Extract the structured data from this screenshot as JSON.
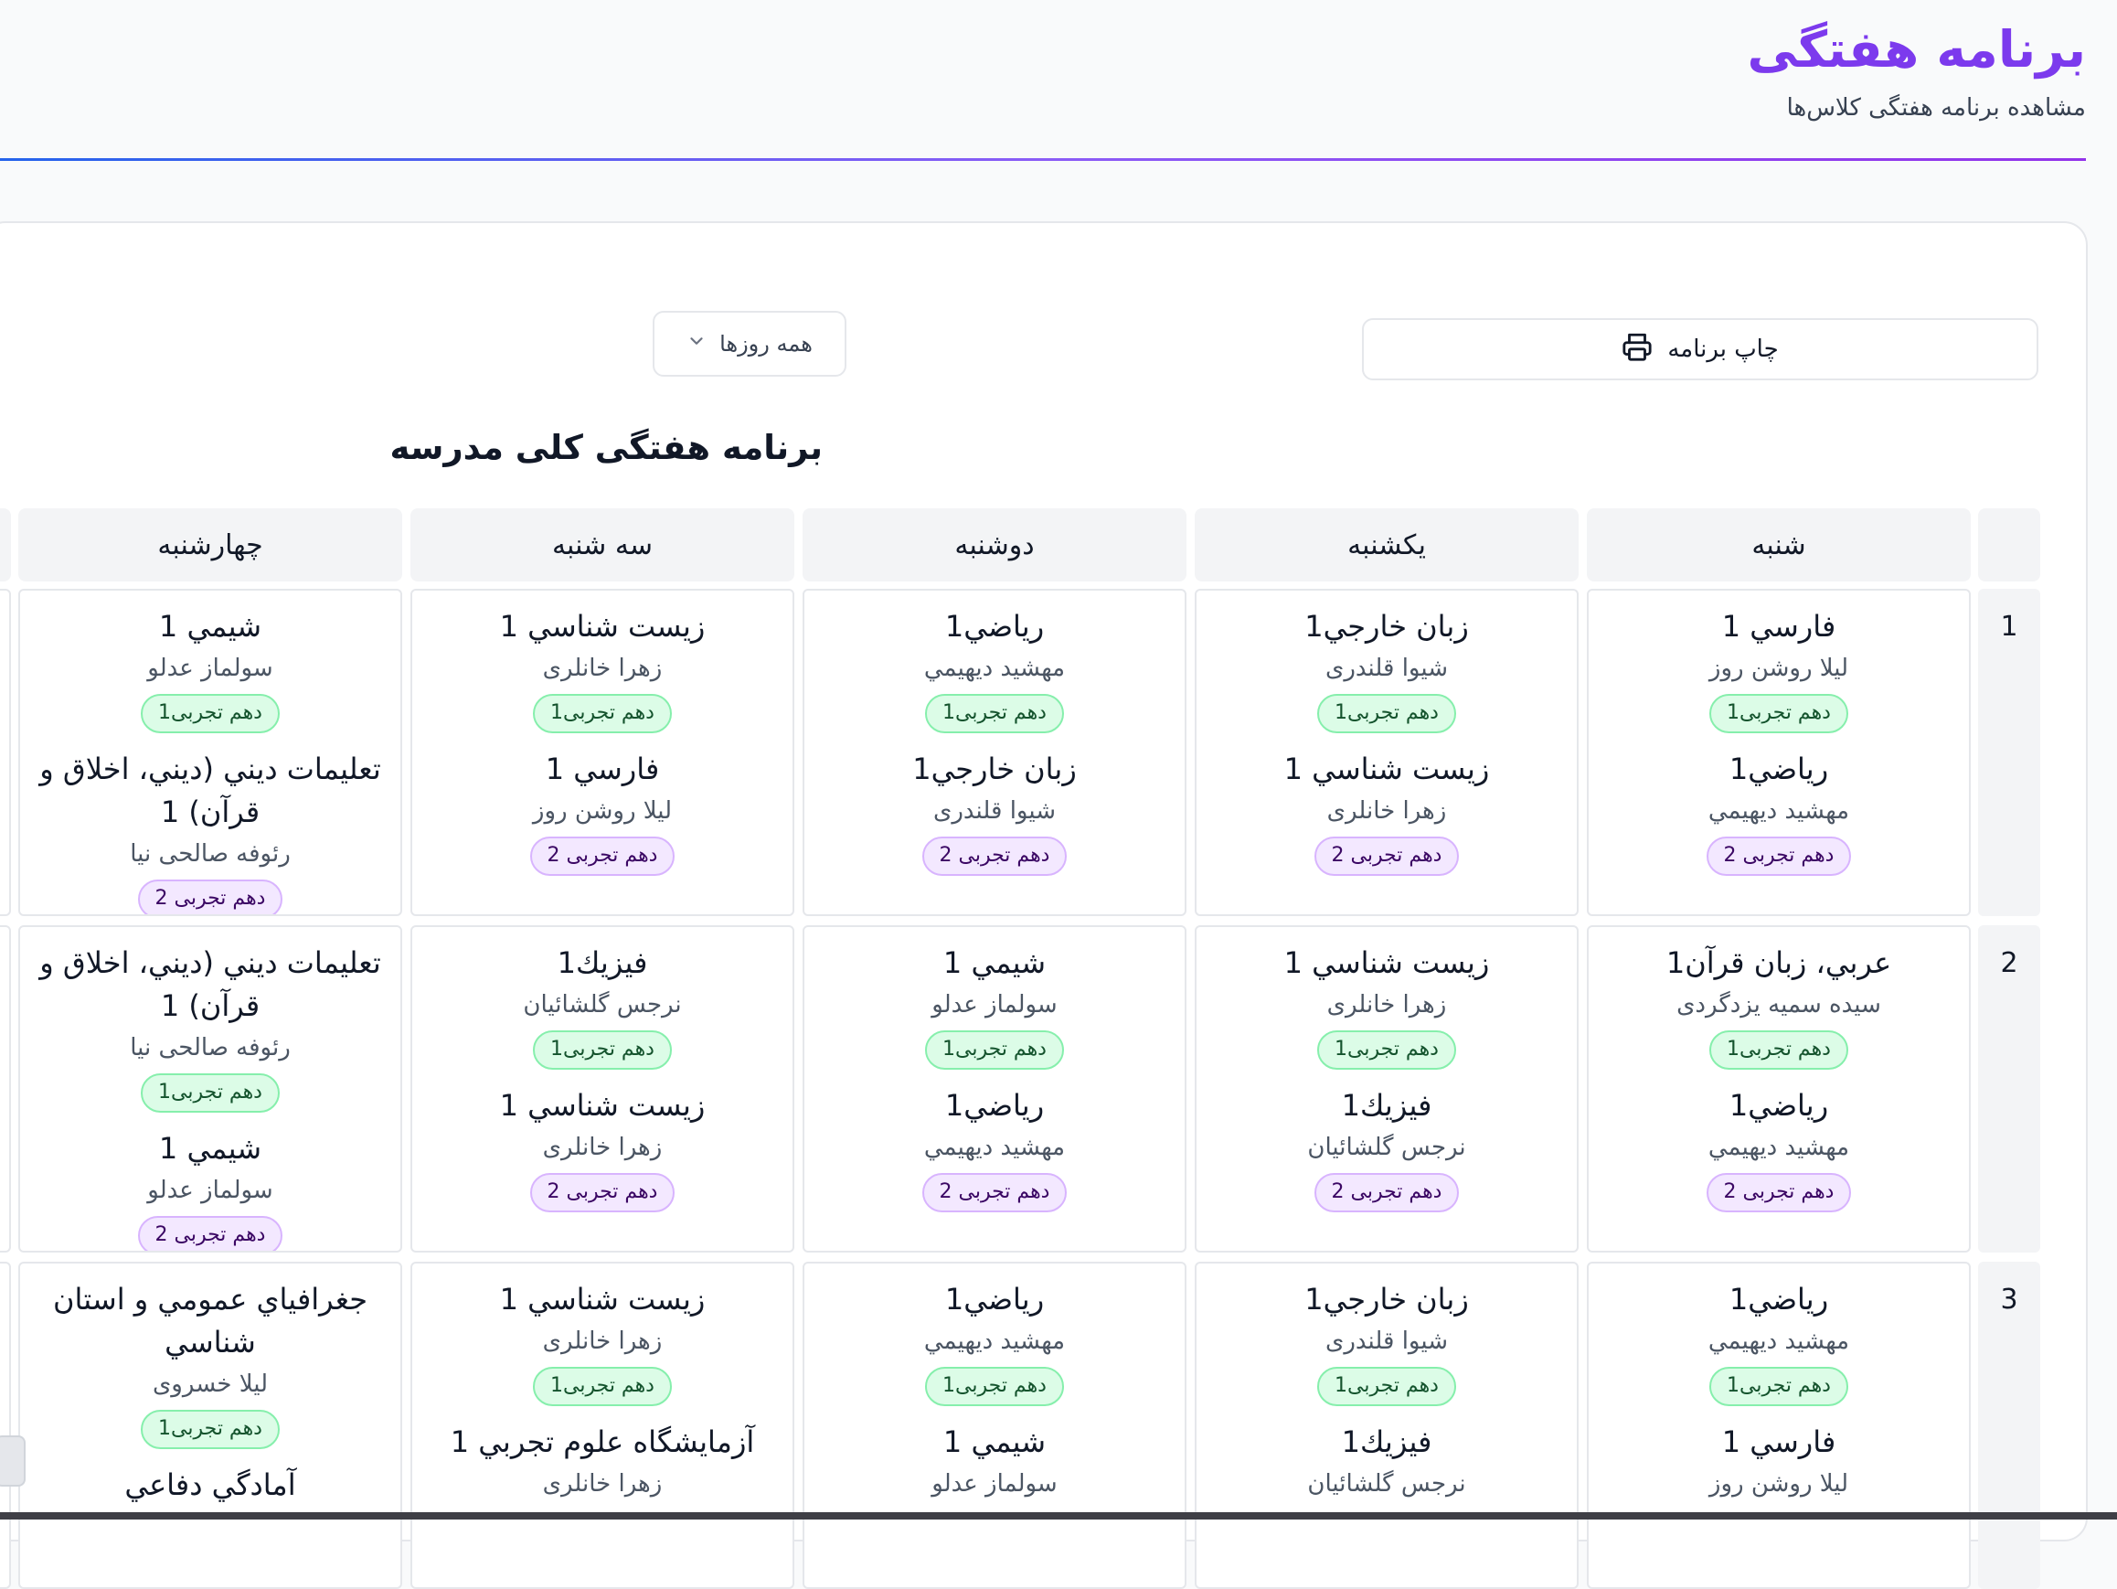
{
  "header": {
    "title": "برنامه هفتگی",
    "subtitle": "مشاهده برنامه هفتگی کلاس‌ها"
  },
  "toolbar": {
    "print_label": "چاپ برنامه",
    "day_filter": "همه روزها"
  },
  "schedule": {
    "title": "برنامه هفتگی کلی مدرسه",
    "days": [
      "شنبه",
      "یکشنبه",
      "دوشنبه",
      "سه شنبه",
      "چهارشنبه"
    ],
    "periods": [
      {
        "number": "1",
        "cells": [
          [
            {
              "subject": "فارسي 1",
              "teacher": "ليلا روشن روز",
              "class": "دهم تجربی1",
              "tone": "g"
            },
            {
              "subject": "رياضي1",
              "teacher": "مهشيد ديهيمي",
              "class": "دهم تجربی 2",
              "tone": "p"
            }
          ],
          [
            {
              "subject": "زبان خارجي1",
              "teacher": "شيوا قلندری",
              "class": "دهم تجربی1",
              "tone": "g"
            },
            {
              "subject": "زيست شناسي 1",
              "teacher": "زهرا خانلری",
              "class": "دهم تجربی 2",
              "tone": "p"
            }
          ],
          [
            {
              "subject": "رياضي1",
              "teacher": "مهشيد ديهيمي",
              "class": "دهم تجربی1",
              "tone": "g"
            },
            {
              "subject": "زبان خارجي1",
              "teacher": "شيوا قلندری",
              "class": "دهم تجربی 2",
              "tone": "p"
            }
          ],
          [
            {
              "subject": "زيست شناسي 1",
              "teacher": "زهرا خانلری",
              "class": "دهم تجربی1",
              "tone": "g"
            },
            {
              "subject": "فارسي 1",
              "teacher": "ليلا روشن روز",
              "class": "دهم تجربی 2",
              "tone": "p"
            }
          ],
          [
            {
              "subject": "شيمي 1",
              "teacher": "سولماز عدلو",
              "class": "دهم تجربی1",
              "tone": "g"
            },
            {
              "subject": "تعليمات ديني (ديني، اخلاق و قرآن) 1",
              "teacher": "رئوفه صالحی نیا",
              "class": "دهم تجربی 2",
              "tone": "p"
            }
          ]
        ]
      },
      {
        "number": "2",
        "cells": [
          [
            {
              "subject": "عربي، زبان قرآن1",
              "teacher": "سیده سمیه یزدگردی",
              "class": "دهم تجربی1",
              "tone": "g"
            },
            {
              "subject": "رياضي1",
              "teacher": "مهشيد ديهيمي",
              "class": "دهم تجربی 2",
              "tone": "p"
            }
          ],
          [
            {
              "subject": "زيست شناسي 1",
              "teacher": "زهرا خانلری",
              "class": "دهم تجربی1",
              "tone": "g"
            },
            {
              "subject": "فيزيك1",
              "teacher": "نرجس گلشائيان",
              "class": "دهم تجربی 2",
              "tone": "p"
            }
          ],
          [
            {
              "subject": "شيمي 1",
              "teacher": "سولماز عدلو",
              "class": "دهم تجربی1",
              "tone": "g"
            },
            {
              "subject": "رياضي1",
              "teacher": "مهشيد ديهيمي",
              "class": "دهم تجربی 2",
              "tone": "p"
            }
          ],
          [
            {
              "subject": "فيزيك1",
              "teacher": "نرجس گلشائيان",
              "class": "دهم تجربی1",
              "tone": "g"
            },
            {
              "subject": "زيست شناسي 1",
              "teacher": "زهرا خانلری",
              "class": "دهم تجربی 2",
              "tone": "p"
            }
          ],
          [
            {
              "subject": "تعليمات ديني (ديني، اخلاق و قرآن) 1",
              "teacher": "رئوفه صالحی نیا",
              "class": "دهم تجربی1",
              "tone": "g"
            },
            {
              "subject": "شيمي 1",
              "teacher": "سولماز عدلو",
              "class": "دهم تجربی 2",
              "tone": "p"
            }
          ]
        ]
      },
      {
        "number": "3",
        "cells": [
          [
            {
              "subject": "رياضي1",
              "teacher": "مهشيد ديهيمي",
              "class": "دهم تجربی1",
              "tone": "g"
            },
            {
              "subject": "فارسي 1",
              "teacher": "ليلا روشن روز",
              "class": "",
              "tone": "p"
            }
          ],
          [
            {
              "subject": "زبان خارجي1",
              "teacher": "شيوا قلندری",
              "class": "دهم تجربی1",
              "tone": "g"
            },
            {
              "subject": "فيزيك1",
              "teacher": "نرجس گلشائيان",
              "class": "",
              "tone": "p"
            }
          ],
          [
            {
              "subject": "رياضي1",
              "teacher": "مهشيد ديهيمي",
              "class": "دهم تجربی1",
              "tone": "g"
            },
            {
              "subject": "شيمي 1",
              "teacher": "سولماز عدلو",
              "class": "",
              "tone": "p"
            }
          ],
          [
            {
              "subject": "زيست شناسي 1",
              "teacher": "زهرا خانلری",
              "class": "دهم تجربی1",
              "tone": "g"
            },
            {
              "subject": "آزمايشگاه علوم تجربي 1",
              "teacher": "زهرا خانلری",
              "class": "",
              "tone": "p"
            }
          ],
          [
            {
              "subject": "جغرافياي عمومي و استان شناسي",
              "teacher": "ليلا خسروی",
              "class": "دهم تجربی1",
              "tone": "g"
            },
            {
              "subject": "آمادگي دفاعي",
              "teacher": "",
              "class": "",
              "tone": "p"
            }
          ]
        ]
      }
    ]
  }
}
